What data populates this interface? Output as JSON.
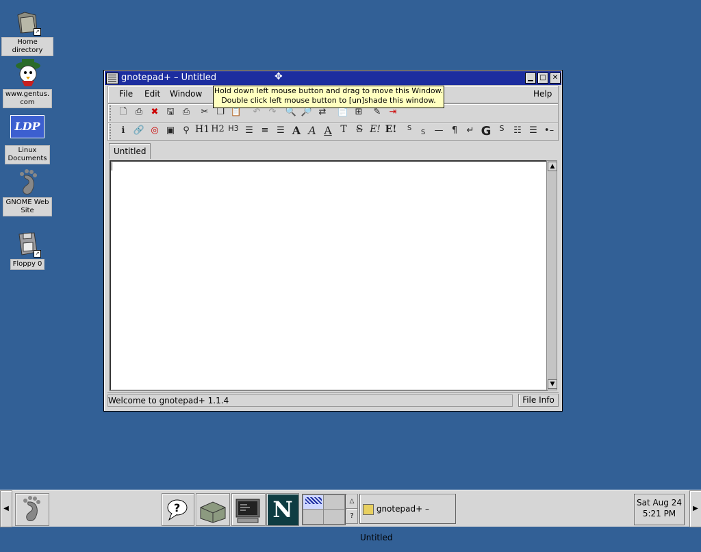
{
  "desktop": {
    "icons": [
      {
        "label": "Home directory",
        "icon": "folder-icon"
      },
      {
        "label": "www.gentus.\ncom",
        "icon": "gentus-logo-icon"
      },
      {
        "label": "LDP",
        "icon": "ldp-logo-icon"
      },
      {
        "label": "Linux\nDocuments",
        "icon": "document-icon"
      },
      {
        "label": "GNOME Web\nSite",
        "icon": "gnome-foot-icon"
      },
      {
        "label": "Floppy 0",
        "icon": "floppy-icon"
      }
    ]
  },
  "window": {
    "title": "gnotepad+ – Untitled",
    "menu": {
      "file": "File",
      "edit": "Edit",
      "window": "Window",
      "help": "Help"
    },
    "tooltip": {
      "line1": "Hold down left mouse button and drag to move this Window.",
      "line2": "Double click left mouse button to [un]shade this window."
    },
    "toolbar2": {
      "h1": "H1",
      "h2": "H2",
      "h3": "H3",
      "a1": "A",
      "a2": "A",
      "a3": "A",
      "t": "T",
      "s": "S",
      "ei": "E!",
      "eb": "E!",
      "sup": "S",
      "sub": "S",
      "para": "¶",
      "g": "G",
      "s2": "S"
    },
    "tab": "Untitled",
    "status": "Welcome to gnotepad+ 1.1.4",
    "file_info": "File Info"
  },
  "panel": {
    "task_label": "gnotepad+ – Untitled",
    "clock": {
      "date": "Sat Aug 24",
      "time": "5:21 PM"
    },
    "netscape_letter": "N",
    "help_glyph": "?"
  }
}
